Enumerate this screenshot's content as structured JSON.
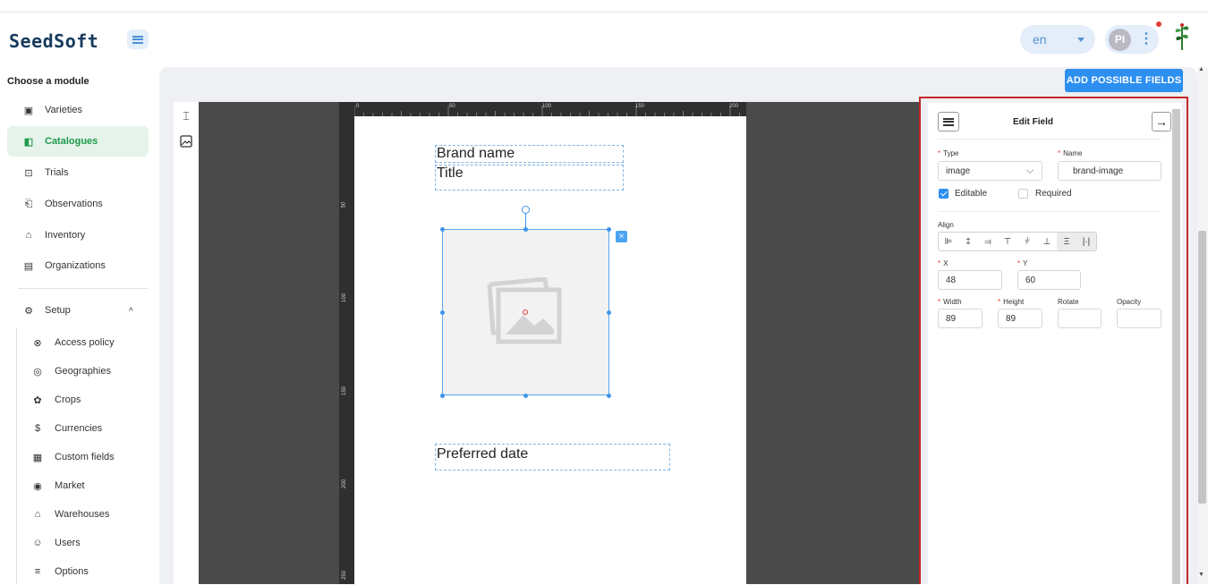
{
  "header": {
    "logo_text": "SeedSoft",
    "language": "en",
    "avatar_initials": "PI"
  },
  "sidebar": {
    "title": "Choose a module",
    "modules": [
      {
        "label": "Varieties",
        "icon": "varieties-icon"
      },
      {
        "label": "Catalogues",
        "icon": "catalogues-icon",
        "active": true
      },
      {
        "label": "Trials",
        "icon": "trials-icon"
      },
      {
        "label": "Observations",
        "icon": "observations-icon"
      },
      {
        "label": "Inventory",
        "icon": "inventory-icon"
      },
      {
        "label": "Organizations",
        "icon": "organizations-icon"
      }
    ],
    "setup_label": "Setup",
    "setup_items": [
      {
        "label": "Access policy",
        "icon": "access-policy-icon"
      },
      {
        "label": "Geographies",
        "icon": "geographies-icon"
      },
      {
        "label": "Crops",
        "icon": "crops-icon"
      },
      {
        "label": "Currencies",
        "icon": "currencies-icon"
      },
      {
        "label": "Custom fields",
        "icon": "custom-fields-icon"
      },
      {
        "label": "Market",
        "icon": "market-icon"
      },
      {
        "label": "Warehouses",
        "icon": "warehouses-icon"
      },
      {
        "label": "Users",
        "icon": "users-icon"
      },
      {
        "label": "Options",
        "icon": "options-icon"
      }
    ]
  },
  "toolbar": {
    "add_fields_label": "ADD POSSIBLE FIELDS"
  },
  "ruler": {
    "top_ticks": [
      "0",
      "50",
      "100",
      "150",
      "200"
    ],
    "left_ticks": [
      "50",
      "100",
      "150",
      "200",
      "250"
    ]
  },
  "canvas": {
    "brand_name": "Brand name",
    "title": "Title",
    "preferred_date": "Preferred date"
  },
  "edit_panel": {
    "title": "Edit Field",
    "type_label": "Type",
    "type_value": "image",
    "name_label": "Name",
    "name_value": "brand-image",
    "editable_label": "Editable",
    "editable": true,
    "required_label": "Required",
    "required": false,
    "align_label": "Align",
    "x_label": "X",
    "x_value": "48",
    "y_label": "Y",
    "y_value": "60",
    "width_label": "Width",
    "width_value": "89",
    "height_label": "Height",
    "height_value": "89",
    "rotate_label": "Rotate",
    "rotate_value": "",
    "opacity_label": "Opacity",
    "opacity_value": ""
  },
  "colors": {
    "primary": "#2d8ff0",
    "active_green": "#1e9b4b",
    "highlight_frame": "#c62828"
  }
}
